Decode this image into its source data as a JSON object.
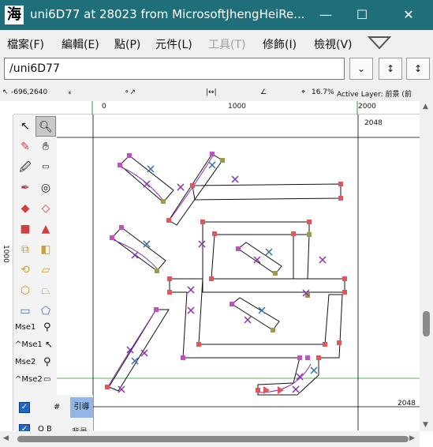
{
  "window": {
    "app_icon_glyph": "海",
    "title": "uni6D77 at 28023 from MicrosoftJhengHeiRe...",
    "minimize": "—",
    "maximize": "☐",
    "close": "✕"
  },
  "menu": {
    "items": [
      {
        "label": "檔案(F)",
        "disabled": false
      },
      {
        "label": "編輯(E)",
        "disabled": false
      },
      {
        "label": "點(P)",
        "disabled": false
      },
      {
        "label": "元件(L)",
        "disabled": false
      },
      {
        "label": "工具(T)",
        "disabled": true
      },
      {
        "label": "修飾(I)",
        "disabled": false
      },
      {
        "label": "檢視(V)",
        "disabled": false
      }
    ]
  },
  "glyph_name_field": {
    "value": "/uni6D77"
  },
  "nav_buttons": {
    "dropdown": "⌄",
    "next": "↕",
    "prev": "↕"
  },
  "status": {
    "coords": "-696,2640",
    "zoom": "16.7%",
    "active_layer": "Active Layer: 前景 (前"
  },
  "ruler": {
    "labels": [
      "0",
      "1000",
      "2000"
    ],
    "left_label": "1000"
  },
  "canvas": {
    "ascent_label_top": "2048",
    "ascent_label_bottom": "2048"
  },
  "tools": {
    "mse": [
      "Mse1",
      "^Mse1",
      "Mse2",
      "^Mse2"
    ]
  },
  "layers": {
    "guide_symbol": "#",
    "guide_label": "引導",
    "back_symbols": "Q  B",
    "back_label": "背景"
  },
  "colors": {
    "titlebar": "#1f6f7a",
    "selected_layer": "#92b6e8",
    "point_red": "#e0575b",
    "point_magenta": "#c04fc0",
    "point_olive": "#9a9a4a",
    "x_blue": "#3070b0",
    "x_purple": "#8a2fb0",
    "guideline": "#2a9a2a"
  }
}
